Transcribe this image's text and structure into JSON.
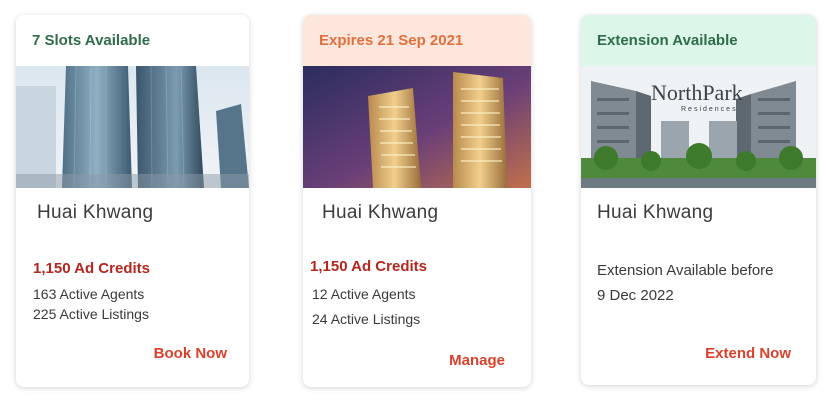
{
  "cards": [
    {
      "header": "7 Slots Available",
      "project": "Huai Khwang",
      "credits": "1,150 Ad Credits",
      "agents": "163 Active Agents",
      "listings": "225 Active Listings",
      "action": "Book Now"
    },
    {
      "header": "Expires 21 Sep 2021",
      "project": "Huai Khwang",
      "credits": "1,150 Ad Credits",
      "agents": "12 Active Agents",
      "listings": "24 Active Listings",
      "action": "Manage"
    },
    {
      "header": "Extension Available",
      "project": "Huai Khwang",
      "extension_line1": "Extension Available before",
      "extension_line2": "9 Dec 2022",
      "logo_name": "NorthPark",
      "logo_sub": "Residences",
      "action": "Extend Now"
    }
  ],
  "colors": {
    "green_header": "#2f6d4a",
    "orange_header": "#e0703f",
    "orange_header_bg": "#fde7dc",
    "mint_header_bg": "#dcf6ea",
    "credits_red": "#b3271e",
    "action_red": "#d9412c"
  }
}
